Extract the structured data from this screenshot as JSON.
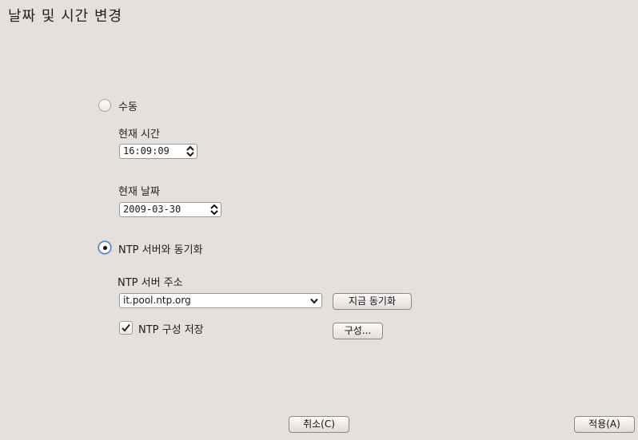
{
  "window": {
    "title": "날짜 및 시간 변경"
  },
  "manual": {
    "radio_label": "수동",
    "selected": false,
    "time_label": "현재 시간",
    "time_value": "16:09:09",
    "date_label": "현재 날짜",
    "date_value": "2009-03-30"
  },
  "ntp": {
    "radio_label": "NTP 서버와 동기화",
    "selected": true,
    "server_label": "NTP 서버 주소",
    "server_value": "it.pool.ntp.org",
    "sync_now_label": "지금 동기화",
    "save_config_label": "NTP 구성 저장",
    "save_config_checked": true,
    "configure_label": "구성..."
  },
  "footer": {
    "cancel_label": "취소(C)",
    "apply_label": "적용(A)"
  },
  "icons": {
    "spin_arrows": "updown-arrows-icon",
    "combo_caret": "chevron-down-icon",
    "checkmark": "checkmark-icon"
  }
}
